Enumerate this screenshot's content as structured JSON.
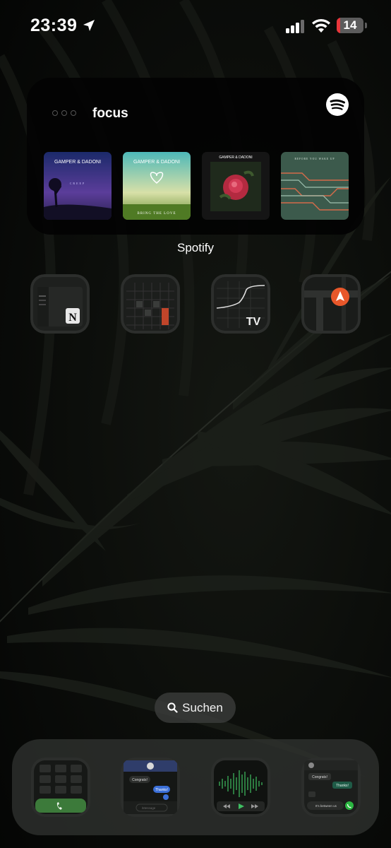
{
  "status_bar": {
    "time": "23:39",
    "battery_level": "14",
    "battery_fraction": 0.14,
    "icons": [
      "location-arrow-icon",
      "cellular-signal-icon",
      "wifi-icon",
      "battery-icon"
    ]
  },
  "widget": {
    "app": "Spotify",
    "playlist_title": "focus",
    "brand_color": "#ffffff",
    "albums": [
      {
        "artist_text": "GAMPER & DADONI",
        "title_text": "CREEP"
      },
      {
        "artist_text": "GAMPER & DADONI",
        "title_text": "BRING THE LOVE"
      },
      {
        "artist_text": "GAMPER & DADONI"
      },
      {
        "title_text": "BEFORE YOU WAKE UP"
      }
    ]
  },
  "apps_row": [
    {
      "name": "Notion",
      "icon": "notion-icon"
    },
    {
      "name": "Calendar grid",
      "icon": "calendar-grid-icon"
    },
    {
      "name": "TradingView",
      "icon": "tradingview-icon"
    },
    {
      "name": "Maps",
      "icon": "maps-arrow-icon"
    }
  ],
  "search": {
    "label": "Suchen",
    "icon": "magnifier-icon"
  },
  "dock": {
    "apps": [
      {
        "name": "Phone",
        "icon": "phone-keypad-icon"
      },
      {
        "name": "Messages",
        "icon": "messages-icon",
        "bubble_received": "Congrats!",
        "bubble_sent": "Thanks!",
        "input_placeholder": "iMessage"
      },
      {
        "name": "Music",
        "icon": "waveform-icon"
      },
      {
        "name": "WhatsApp",
        "icon": "whatsapp-icon",
        "bubble_received": "Congrats!",
        "bubble_sent": "Thanks!",
        "footer_text": "It's between us"
      }
    ]
  },
  "colors": {
    "accent_red": "#e8363b",
    "phone_green": "#3c7a3a",
    "maps_orange": "#e8572a",
    "messages_blue": "#3b6fd8"
  }
}
